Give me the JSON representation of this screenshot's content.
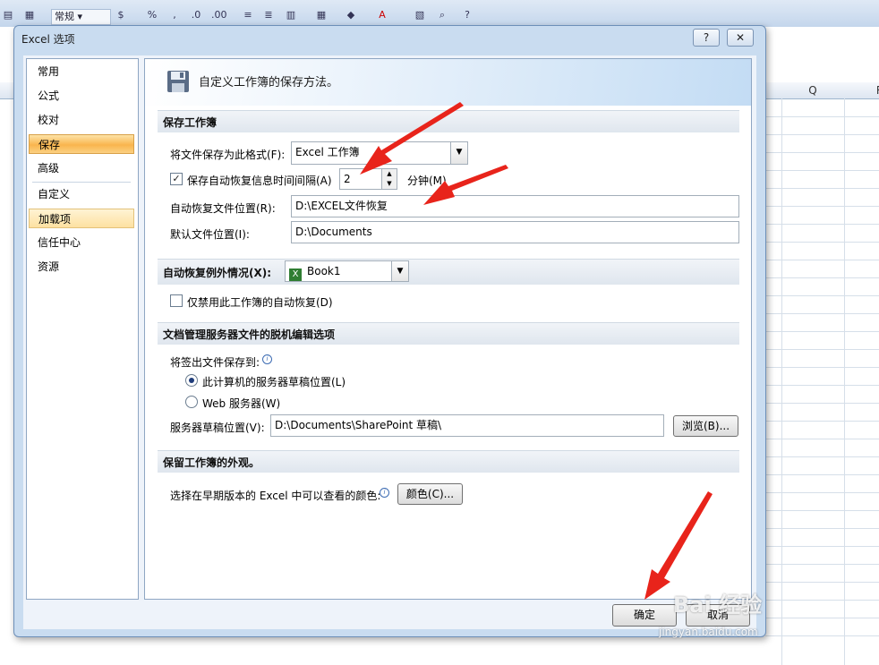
{
  "excel": {
    "number_format": "常规",
    "column_labels": [
      "Q",
      "R"
    ]
  },
  "dialog": {
    "title": "Excel 选项",
    "help_glyph": "?",
    "close_glyph": "✕",
    "nav": [
      "常用",
      "公式",
      "校对",
      "保存",
      "高级",
      "自定义",
      "加载项",
      "信任中心",
      "资源"
    ],
    "selected_nav": "保存",
    "banner": "自定义工作簿的保存方法。",
    "sections": {
      "save": {
        "title": "保存工作簿",
        "format_label": "将文件保存为此格式(F):",
        "format_value": "Excel 工作簿",
        "autorecover_label": "保存自动恢复信息时间间隔(A)",
        "autorecover_checked": true,
        "interval_value": "2",
        "interval_unit": "分钟(M)",
        "autorecover_path_label": "自动恢复文件位置(R):",
        "autorecover_path": "D:\\EXCEL文件恢复",
        "default_path_label": "默认文件位置(I):",
        "default_path": "D:\\Documents"
      },
      "exceptions": {
        "title": "自动恢复例外情况(X):",
        "workbook": "Book1",
        "disable_label": "仅禁用此工作簿的自动恢复(D)",
        "disable_checked": false
      },
      "offline": {
        "title": "文档管理服务器文件的脱机编辑选项",
        "save_to_label": "将签出文件保存到:",
        "option_local": "此计算机的服务器草稿位置(L)",
        "option_web": "Web 服务器(W)",
        "selected": "local",
        "drafts_label": "服务器草稿位置(V):",
        "drafts_path": "D:\\Documents\\SharePoint 草稿\\",
        "browse_label": "浏览(B)..."
      },
      "appearance": {
        "title": "保留工作簿的外观。",
        "colors_label": "选择在早期版本的 Excel 中可以查看的颜色:",
        "colors_button": "颜色(C)..."
      }
    },
    "ok_label": "确定",
    "cancel_label": "取消"
  },
  "watermark": {
    "brand": "Bai 经验",
    "url": "jingyan.baidu.com"
  },
  "annotation_color": "#e8241b"
}
